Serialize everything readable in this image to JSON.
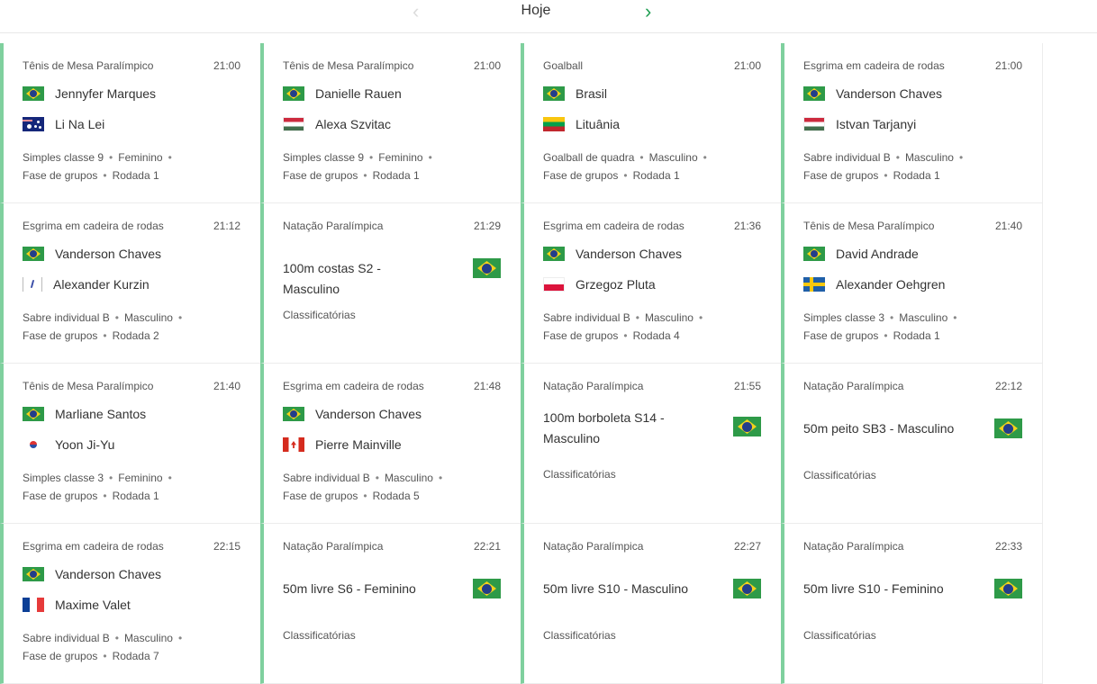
{
  "header": {
    "day": "Hoje",
    "prev_icon": "chevron-left-icon",
    "next_icon": "chevron-right-icon"
  },
  "accent_color": "#7fd09e",
  "cards": [
    {
      "sport": "Tênis de Mesa Paralímpico",
      "time": "21:00",
      "team1": "Jennyfer Marques",
      "flag1": "br",
      "team2": "Li Na Lei",
      "flag2": "au",
      "meta1": "Simples classe 9",
      "meta2": "Feminino",
      "meta3": "Fase de grupos",
      "meta4": "Rodada 1"
    },
    {
      "sport": "Tênis de Mesa Paralímpico",
      "time": "21:00",
      "team1": "Danielle Rauen",
      "flag1": "br",
      "team2": "Alexa Szvitac",
      "flag2": "hu",
      "meta1": "Simples classe 9",
      "meta2": "Feminino",
      "meta3": "Fase de grupos",
      "meta4": "Rodada 1"
    },
    {
      "sport": "Goalball",
      "time": "21:00",
      "team1": "Brasil",
      "flag1": "br",
      "team2": "Lituânia",
      "flag2": "lt",
      "meta1": "Goalball de quadra",
      "meta2": "Masculino",
      "meta3": "Fase de grupos",
      "meta4": "Rodada 1"
    },
    {
      "sport": "Esgrima em cadeira de rodas",
      "time": "21:00",
      "team1": "Vanderson Chaves",
      "flag1": "br",
      "team2": "Istvan Tarjanyi",
      "flag2": "hu",
      "meta1": "Sabre individual B",
      "meta2": "Masculino",
      "meta3": "Fase de grupos",
      "meta4": "Rodada 1"
    },
    {
      "sport": "Esgrima em cadeira de rodas",
      "time": "21:12",
      "team1": "Vanderson Chaves",
      "flag1": "br",
      "team2": "Alexander Kurzin",
      "flag2": "npa",
      "meta1": "Sabre individual B",
      "meta2": "Masculino",
      "meta3": "Fase de grupos",
      "meta4": "Rodada 2"
    },
    {
      "sport": "Natação Paralímpica",
      "time": "21:29",
      "event": "100m costas S2 - Masculino",
      "phase": "Classificatórias"
    },
    {
      "sport": "Esgrima em cadeira de rodas",
      "time": "21:36",
      "team1": "Vanderson Chaves",
      "flag1": "br",
      "team2": "Grzegoz Pluta",
      "flag2": "pl",
      "meta1": "Sabre individual B",
      "meta2": "Masculino",
      "meta3": "Fase de grupos",
      "meta4": "Rodada 4"
    },
    {
      "sport": "Tênis de Mesa Paralímpico",
      "time": "21:40",
      "team1": "David Andrade",
      "flag1": "br",
      "team2": "Alexander Oehgren",
      "flag2": "se",
      "meta1": "Simples classe 3",
      "meta2": "Masculino",
      "meta3": "Fase de grupos",
      "meta4": "Rodada 1"
    },
    {
      "sport": "Tênis de Mesa Paralímpico",
      "time": "21:40",
      "team1": "Marliane Santos",
      "flag1": "br",
      "team2": "Yoon Ji-Yu",
      "flag2": "kr",
      "meta1": "Simples classe 3",
      "meta2": "Feminino",
      "meta3": "Fase de grupos",
      "meta4": "Rodada 1"
    },
    {
      "sport": "Esgrima em cadeira de rodas",
      "time": "21:48",
      "team1": "Vanderson Chaves",
      "flag1": "br",
      "team2": "Pierre Mainville",
      "flag2": "ca",
      "meta1": "Sabre individual B",
      "meta2": "Masculino",
      "meta3": "Fase de grupos",
      "meta4": "Rodada 5"
    },
    {
      "sport": "Natação Paralímpica",
      "time": "21:55",
      "event": "100m borboleta S14 - Masculino",
      "phase": "Classificatórias",
      "tall": true
    },
    {
      "sport": "Natação Paralímpica",
      "time": "22:12",
      "event": "50m peito SB3 - Masculino",
      "phase": "Classificatórias"
    },
    {
      "sport": "Esgrima em cadeira de rodas",
      "time": "22:15",
      "team1": "Vanderson Chaves",
      "flag1": "br",
      "team2": "Maxime Valet",
      "flag2": "fr",
      "meta1": "Sabre individual B",
      "meta2": "Masculino",
      "meta3": "Fase de grupos",
      "meta4": "Rodada 7"
    },
    {
      "sport": "Natação Paralímpica",
      "time": "22:21",
      "event": "50m livre S6 - Feminino",
      "phase": "Classificatórias"
    },
    {
      "sport": "Natação Paralímpica",
      "time": "22:27",
      "event": "50m livre S10 - Masculino",
      "phase": "Classificatórias"
    },
    {
      "sport": "Natação Paralímpica",
      "time": "22:33",
      "event": "50m livre S10 - Feminino",
      "phase": "Classificatórias"
    }
  ]
}
